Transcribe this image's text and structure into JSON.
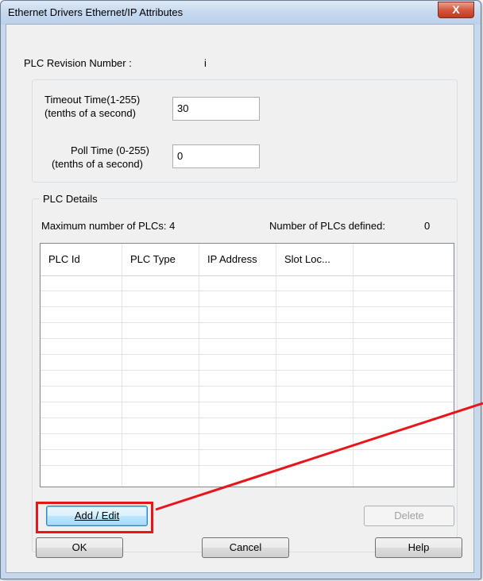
{
  "window": {
    "title": "Ethernet Drivers Ethernet/IP  Attributes",
    "close_glyph": "X"
  },
  "plc_revision": {
    "label": "PLC Revision Number :",
    "value": "i"
  },
  "timeout": {
    "label_line1": "Timeout Time(1-255)",
    "label_line2": "(tenths of a second)",
    "value": "30"
  },
  "poll": {
    "label_line1": "Poll Time (0-255)",
    "label_line2": "(tenths of a second)",
    "value": "0"
  },
  "plc_details": {
    "group_label": "PLC Details",
    "max_plcs": "Maximum number of PLCs: 4",
    "defined_plcs_label": "Number of PLCs defined:",
    "defined_plcs_value": "0",
    "columns": [
      "PLC Id",
      "PLC Type",
      "IP Address",
      "Slot Loc..."
    ],
    "rows": []
  },
  "buttons": {
    "add_edit": "Add / Edit",
    "delete": "Delete",
    "ok": "OK",
    "cancel": "Cancel",
    "help": "Help"
  },
  "colors": {
    "annotation": "#e8161b",
    "title_bar": "#c4d7ee",
    "client": "#f0f0f0"
  }
}
